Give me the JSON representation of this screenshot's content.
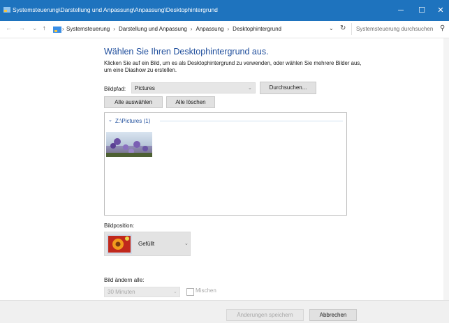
{
  "window": {
    "title": "Systemsteuerung\\Darstellung und Anpassung\\Anpassung\\Desktophintergrund",
    "minimize_glyph": "─",
    "maximize_glyph": "☐",
    "close_glyph": "✕",
    "accent_color": "#1e73be"
  },
  "nav": {
    "back_glyph": "←",
    "forward_glyph": "→",
    "recent_glyph": "⌄",
    "up_glyph": "↑",
    "breadcrumb": [
      "Systemsteuerung",
      "Darstellung und Anpassung",
      "Anpassung",
      "Desktophintergrund"
    ],
    "separator": "›",
    "refresh_glyph": "↻",
    "dropdown_glyph": "⌄",
    "search_placeholder": "Systemsteuerung durchsuchen",
    "search_glyph": "⚲"
  },
  "main": {
    "heading": "Wählen Sie Ihren Desktophintergrund aus.",
    "description": "Klicken Sie auf ein Bild, um es als Desktophintergrund zu verwenden, oder wählen Sie mehrere Bilder aus, um eine Diashow zu erstellen.",
    "path_label": "Bildpfad:",
    "path_value": "Pictures",
    "browse_button": "Durchsuchen...",
    "select_all_button": "Alle auswählen",
    "clear_all_button": "Alle löschen",
    "group_header": "Z:\\Pictures (1)",
    "group_chevron": "⌄",
    "position_label": "Bildposition:",
    "position_value": "Gefüllt",
    "interval_label": "Bild ändern alle:",
    "interval_value": "30 Minuten",
    "shuffle_label": "Mischen"
  },
  "footer": {
    "save_button": "Änderungen speichern",
    "cancel_button": "Abbrechen"
  }
}
